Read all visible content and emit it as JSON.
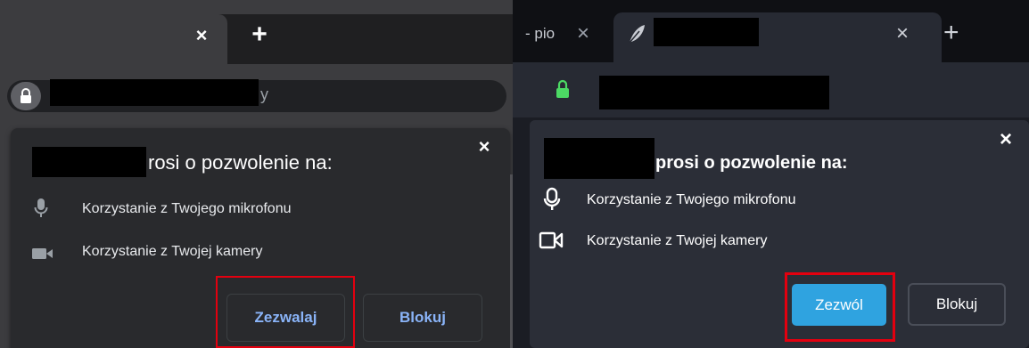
{
  "left_panel": {
    "tab_close_glyph": "×",
    "new_tab_glyph": "+",
    "url_tail": "y",
    "dialog": {
      "title": "rosi o pozwolenie na:",
      "close_glyph": "×",
      "permissions": [
        {
          "icon": "microphone-icon",
          "label": "Korzystanie z Twojego mikrofonu"
        },
        {
          "icon": "camera-icon",
          "label": "Korzystanie z Twojej kamery"
        }
      ],
      "allow_label": "Zezwalaj",
      "block_label": "Blokuj"
    },
    "colors": {
      "accent": "#8ab4f8",
      "highlight": "#e3000f"
    }
  },
  "right_panel": {
    "prev_tab_text": "- pio",
    "prev_tab_close_glyph": "×",
    "tab_close_glyph": "×",
    "new_tab_glyph": "+",
    "dialog": {
      "title": "prosi o pozwolenie na:",
      "close_glyph": "×",
      "permissions": [
        {
          "icon": "microphone-icon",
          "label": "Korzystanie z Twojego mikrofonu"
        },
        {
          "icon": "camera-icon",
          "label": "Korzystanie z Twojej kamery"
        }
      ],
      "allow_label": "Zezwól",
      "block_label": "Blokuj"
    },
    "colors": {
      "accent": "#2fa3e0",
      "lock": "#4cd964",
      "highlight": "#e3000f"
    }
  }
}
